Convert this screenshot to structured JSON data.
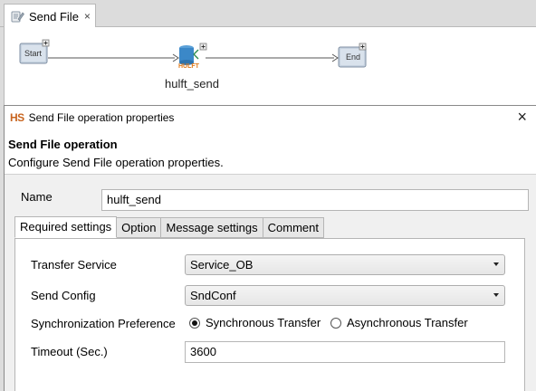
{
  "editor_tab": {
    "label": "Send File",
    "close": "×",
    "icon": "script-edit-icon"
  },
  "flow": {
    "start_label": "Start",
    "end_label": "End",
    "icon_badge": "HULFT",
    "caption": "hulft_send",
    "start_color": "#b8c7d9",
    "end_color": "#b8c7d9"
  },
  "dialog": {
    "logo": "HS",
    "title": "Send File operation properties",
    "close": "×",
    "heading": "Send File operation",
    "subheading": "Configure Send File operation properties.",
    "name_label": "Name",
    "name_value": "hulft_send",
    "tabs": [
      {
        "label": "Required settings"
      },
      {
        "label": "Option"
      },
      {
        "label": "Message settings"
      },
      {
        "label": "Comment"
      }
    ],
    "active_tab": "Required settings",
    "fields": {
      "transfer_service_label": "Transfer Service",
      "transfer_service_value": "Service_OB",
      "send_config_label": "Send Config",
      "send_config_value": "SndConf",
      "sync_label": "Synchronization Preference",
      "sync_option_1": "Synchronous Transfer",
      "sync_option_2": "Asynchronous Transfer",
      "sync_selected": "Synchronous Transfer",
      "timeout_label": "Timeout (Sec.)",
      "timeout_value": "3600"
    },
    "logo_color": "#c8641e"
  }
}
